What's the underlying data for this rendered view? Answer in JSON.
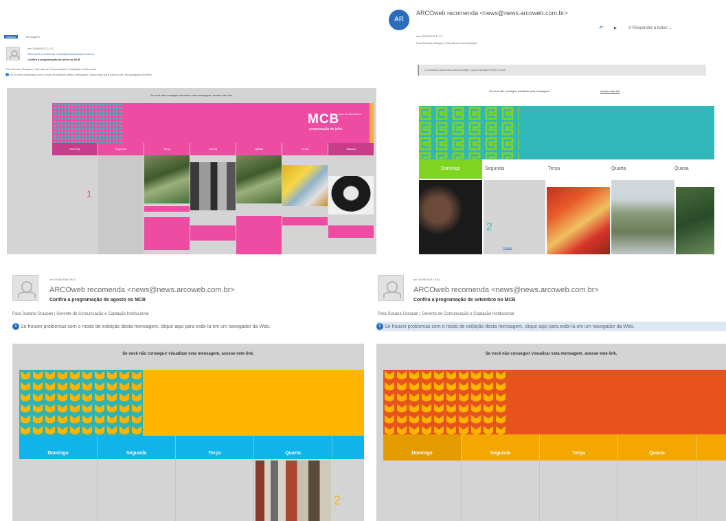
{
  "colors": {
    "pink": "#ee4ba3",
    "teal": "#30bfc0",
    "lime": "#7fd321",
    "yellow": "#ffb400",
    "cyan": "#10b3ea",
    "orange": "#e6531c",
    "amber": "#f3a700",
    "grey": "#d4d4d4",
    "link": "#2a6ebb"
  },
  "p1": {
    "tab_active": "Outlook",
    "tab_label": "Mensagem",
    "date": "sex 30/06/2017 11:12",
    "from": "ARCOweb recomenda <news@news.arcoweb.com.br>",
    "subject": "Confira a programação de julho no MCB",
    "to": "Para   Suzana Graspan | Gerente de Comunicação e Captação Institucional",
    "info": "Se houver problemas com o modo de exibição desta mensagem, clique aqui para exibi-la em um navegador da Web.",
    "view_link": "Se você não conseguir visualizar esta mensagem, acesse este link.",
    "logo": "MCB",
    "logo_sub": "museu da casa brasileira",
    "programacao": "programação de julho",
    "days": [
      "Domingo",
      "Segunda",
      "Terça",
      "Quarta",
      "Quinta",
      "Sexta",
      "Sábado"
    ],
    "day_number": "1"
  },
  "p2": {
    "avatar_initials": "AR",
    "from": "ARCOweb recomenda <news@news.arcoweb.com.br>",
    "date": "sex 03/05/2018 11:12",
    "to": "Para   Suzana Graspan | Gerente de Comunicação  ",
    "reply_all": "Responder a todos",
    "notice": "O conteúdo bloqueado para proteger sua privacidade neste e-mail.",
    "view_link": "Se você não conseguir visualizar esta mensagem,",
    "view_link_anchor": "acesse este link",
    "days": [
      "Domingo",
      "Segunda",
      "Terça",
      "Quarta",
      "Quinta"
    ],
    "day_number": "2",
    "feriado": "Feriado"
  },
  "p3": {
    "date": "sex 03/08/2018 09:42",
    "from": "ARCOweb recomenda <news@news.arcoweb.com.br>",
    "subject": "Confira a programação de agosto no MCB",
    "to": "Para   Suzana Graspan | Gerente de Comunicação e Captação Institucional",
    "info": "Se houver problemas com o modo de exibição desta mensagem, clique aqui para exibi-la em um navegador da Web.",
    "view_link": "Se você não conseguir visualizar esta mensagem, acesse este link.",
    "days": [
      "Domingo",
      "Segunda",
      "Terça",
      "Quarta"
    ],
    "day_number": "2"
  },
  "p4": {
    "date": "sex 31/08/2018 10:32",
    "from": "ARCOweb recomenda <news@news.arcoweb.com.br>",
    "subject": "Confira a programação de setembro no MCB",
    "to": "Para   Suzana Graspan | Gerente de Comunicação e Captação Institucional",
    "info": "Se houver problemas com o modo de exibição desta mensagem, clique aqui para exibi-la em um navegador da Web.",
    "view_link": "Se você não conseguir visualizar esta mensagem, acesse este link.",
    "days": [
      "Domingo",
      "Segunda",
      "Terça",
      "Quarta"
    ]
  }
}
